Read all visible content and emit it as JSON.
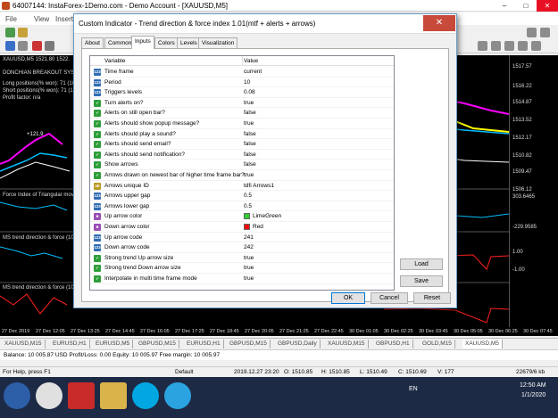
{
  "app": {
    "title": "64007144: InstaForex-1Demo.com - Demo Account - [XAUUSD,M5]",
    "menu": [
      "File",
      "View",
      "Insert"
    ]
  },
  "chart": {
    "indicator_title": "XAUUSD,M5  1521.80 1522.",
    "donchian": "DONCHIAN BREAKOUT SYS",
    "long_positions": "Long positions(% won): 71 (100",
    "short_positions": "Short positions(% won): 71 (100",
    "profit_factor": "Profit factor: n/a",
    "plus_label": "+121.9",
    "sub1": "Force Index of Triangular moving",
    "sub2": "MS trend direction & force (10)",
    "sub3": "MS trend direction & force (10)",
    "price_ticks": [
      "1517.57",
      "1516.22",
      "1514.87",
      "1513.52",
      "1512.17",
      "1510.82",
      "1509.47",
      "1506.12",
      "303.6465",
      "-229.9585",
      "1.00",
      "-1.00"
    ],
    "time_ticks": [
      "27 Dec 2019",
      "27 Dec 12:05",
      "27 Dec 13:25",
      "27 Dec 14:45",
      "27 Dec 16:05",
      "27 Dec 17:25",
      "27 Dec 18:45",
      "27 Dec 20:05",
      "27 Dec 21:25",
      "27 Dec 22:45",
      "30 Dec 01:05",
      "30 Dec 02:25",
      "30 Dec 03:45",
      "30 Dec 05:05",
      "30 Dec 06:25",
      "30 Dec 07:45"
    ]
  },
  "symbol_tabs": [
    "XAUUSD,M15",
    "EURUSD,H1",
    "EURUSD,M5",
    "GBPUSD,M15",
    "EURUSD,H1",
    "GBPUSD,M15",
    "GBPUSD,Daily",
    "XAUUSD,M15",
    "GBPUSD,H1",
    "GOLD,M15",
    "XAUUSD,M5"
  ],
  "balance_bar": "Balance: 10 005.87 USD  Profit/Loss: 0.00  Equity: 10 005.97  Free margin: 10 005.97",
  "status": {
    "help": "For Help, press F1",
    "profile": "Default",
    "datetime": "2019.12.27 23:20",
    "open": "O: 1510.85",
    "high": "H: 1510.85",
    "low": "L: 1510.49",
    "close": "C: 1510.69",
    "volume": "V: 177",
    "traffic": "22679/6 kb"
  },
  "taskbar": {
    "lang": "EN",
    "time": "12:50 AM",
    "date": "1/1/2020"
  },
  "dialog": {
    "title": "Custom Indicator - Trend direction & force index 1.01(mtf + alerts + arrows)",
    "close_glyph": "✕",
    "tabs": [
      "About",
      "Common",
      "Inputs",
      "Colors",
      "Levels",
      "Visualization"
    ],
    "active_tab": "Inputs",
    "columns": {
      "variable": "Variable",
      "value": "Value"
    },
    "rows": [
      {
        "type": "num",
        "name": "Time frame",
        "value": "current"
      },
      {
        "type": "num",
        "name": "Period",
        "value": "10"
      },
      {
        "type": "num",
        "name": "Triggers levels",
        "value": "0.08"
      },
      {
        "type": "bool",
        "name": "Turn alerts on?",
        "value": "true"
      },
      {
        "type": "bool",
        "name": "Alerts on still open bar?",
        "value": "false"
      },
      {
        "type": "bool",
        "name": "Alerts should show popup message?",
        "value": "true"
      },
      {
        "type": "bool",
        "name": "Alerts should play a sound?",
        "value": "false"
      },
      {
        "type": "bool",
        "name": "Alerts should send email?",
        "value": "false"
      },
      {
        "type": "bool",
        "name": "Alerts should send notification?",
        "value": "false"
      },
      {
        "type": "bool",
        "name": "Show arrows",
        "value": "false"
      },
      {
        "type": "bool",
        "name": "Arrows drawn on newest bar of higher time frame bar?",
        "value": "true"
      },
      {
        "type": "str",
        "name": "Arrows unique ID",
        "value": "tdfi Arrows1"
      },
      {
        "type": "num",
        "name": "Arrows upper gap",
        "value": "0.5"
      },
      {
        "type": "num",
        "name": "Arrows lower gap",
        "value": "0.5"
      },
      {
        "type": "color",
        "name": "Up arrow color",
        "value": "LimeGreen",
        "swatch": "#32cd32"
      },
      {
        "type": "color",
        "name": "Down arrow color",
        "value": "Red",
        "swatch": "#ff0000"
      },
      {
        "type": "num",
        "name": "Up arrow code",
        "value": "241"
      },
      {
        "type": "num",
        "name": "Down arrow code",
        "value": "242"
      },
      {
        "type": "bool",
        "name": "Strong trend Up arrow size",
        "value": "true"
      },
      {
        "type": "bool",
        "name": "Strong trend Down arrow size",
        "value": "true"
      },
      {
        "type": "bool",
        "name": "Interpolate in multi time frame mode",
        "value": "true"
      }
    ],
    "type_glyphs": {
      "num": "123",
      "bool": "✓",
      "str": "ab",
      "color": "■"
    },
    "buttons": {
      "load": "Load",
      "save": "Save",
      "ok": "OK",
      "cancel": "Cancel",
      "reset": "Reset"
    }
  },
  "colors": {
    "chart_bg": "#000000",
    "dialog_accent": "#6a9bc8",
    "close_red": "#c74a3a",
    "series_magenta": "#ff00ff",
    "series_yellow": "#ffff00",
    "series_cyan": "#00bfff",
    "series_red": "#ff2020",
    "series_green": "#20c020"
  }
}
